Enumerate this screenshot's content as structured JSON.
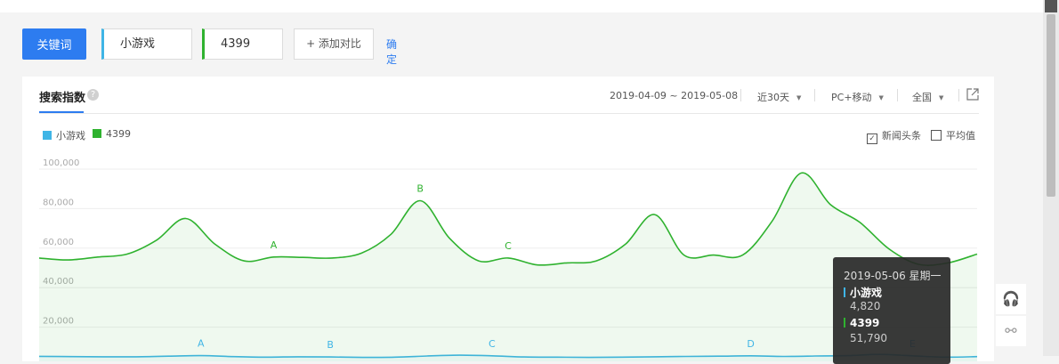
{
  "toolbar": {
    "keyword_label": "关键词",
    "keywords": [
      "小游戏",
      "4399"
    ],
    "add_compare": "+ 添加对比",
    "confirm": "确定"
  },
  "panel": {
    "title": "搜索指数",
    "help": "?",
    "date_range": "2019-04-09 ~ 2019-05-08",
    "period": "近30天",
    "device": "PC+移动",
    "region": "全国",
    "news_headline": "新闻头条",
    "news_checked": "✓",
    "average": "平均值"
  },
  "colors": {
    "accent": "#2d7cf0",
    "series1": "#3fb5e6",
    "series2": "#2fb22f"
  },
  "chart_data": {
    "type": "line",
    "y_ticks": [
      "100,000",
      "80,000",
      "60,000",
      "40,000",
      "20,000"
    ],
    "ylim": [
      0,
      100000
    ],
    "series": [
      {
        "name": "小游戏",
        "color": "#3fb5e6",
        "values": [
          5200,
          5100,
          5000,
          5000,
          5300,
          5600,
          5100,
          4800,
          5000,
          4900,
          4700,
          4800,
          5400,
          5800,
          5500,
          4900,
          4800,
          4700,
          4800,
          5000,
          5200,
          5300,
          5500,
          5200,
          5400,
          5600,
          6200,
          5500,
          4820,
          5100
        ],
        "annotations": [
          {
            "label": "A",
            "index": 5
          },
          {
            "label": "B",
            "index": 9
          },
          {
            "label": "C",
            "index": 14
          },
          {
            "label": "D",
            "index": 22
          },
          {
            "label": "E",
            "index": 27
          }
        ]
      },
      {
        "name": "4399",
        "color": "#2fb22f",
        "values": [
          55000,
          54000,
          55500,
          57000,
          64000,
          75000,
          62000,
          53500,
          55500,
          55300,
          55000,
          57500,
          67000,
          84000,
          65000,
          53500,
          55000,
          51500,
          52500,
          53500,
          62000,
          77000,
          56500,
          56500,
          56500,
          73500,
          98000,
          82000,
          73000,
          59500,
          51790,
          52500,
          57000
        ],
        "annotations": [
          {
            "label": "A",
            "index": 8
          },
          {
            "label": "B",
            "index": 13
          },
          {
            "label": "C",
            "index": 16
          }
        ]
      }
    ]
  },
  "tooltip": {
    "date": "2019-05-06 星期一",
    "rows": [
      {
        "name": "小游戏",
        "value": "4,820"
      },
      {
        "name": "4399",
        "value": "51,790"
      }
    ]
  },
  "side_buttons": {
    "headset": "🎧",
    "share": "⚯"
  }
}
